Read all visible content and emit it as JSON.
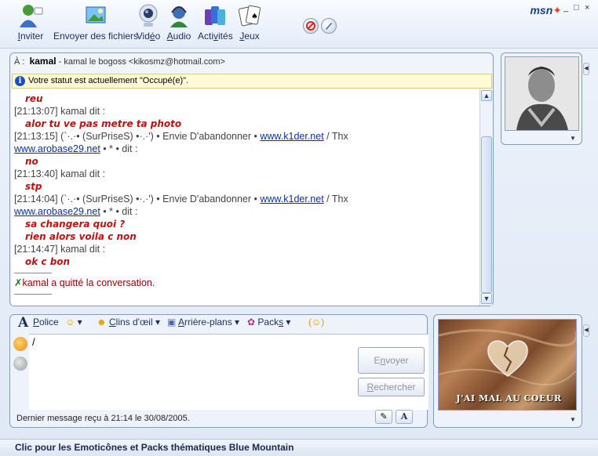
{
  "window": {
    "brand": "msn",
    "controls": [
      "_",
      "□",
      "×"
    ]
  },
  "toolbar": {
    "items": [
      {
        "label_pre": "",
        "label_key": "I",
        "label_post": "nviter",
        "icon": "invite-contacts-icon"
      },
      {
        "label_pre": "Envoyer des fichiers",
        "label_key": "",
        "label_post": "",
        "icon": "send-files-icon"
      },
      {
        "label_pre": "Vid",
        "label_key": "é",
        "label_post": "o",
        "icon": "webcam-icon"
      },
      {
        "label_pre": "",
        "label_key": "A",
        "label_post": "udio",
        "icon": "headset-icon"
      },
      {
        "label_pre": "Acti",
        "label_key": "v",
        "label_post": "ités",
        "icon": "activities-icon"
      },
      {
        "label_pre": "",
        "label_key": "J",
        "label_post": "eux",
        "icon": "cards-icon"
      }
    ]
  },
  "conversation": {
    "to_prefix": "À :",
    "contact_name": "kamal",
    "contact_details": " - kamal le bogoss <kikosmz@hotmail.com>",
    "status_notice": "Votre statut est actuellement \"Occupé(e)\"."
  },
  "history": [
    {
      "type": "msg",
      "text": "reu"
    },
    {
      "type": "sys",
      "text": "[21:13:07] kamal dit :"
    },
    {
      "type": "msg",
      "text": "alor tu ve pas metre ta photo"
    },
    {
      "type": "sys-link",
      "pre": "[21:13:15] (`·.·• (SurPriseS) •·.·') • Envie D'abandonner • ",
      "link": "www.k1der.net",
      "post": " / Thx"
    },
    {
      "type": "sys-link2",
      "link": "www.arobase29.net",
      "post": " • * • dit :"
    },
    {
      "type": "msg",
      "text": "no"
    },
    {
      "type": "sys",
      "text": "[21:13:40] kamal dit :"
    },
    {
      "type": "msg",
      "text": "stp"
    },
    {
      "type": "sys-link",
      "pre": "[21:14:04] (`·.·• (SurPriseS) •·.·') • Envie D'abandonner • ",
      "link": "www.k1der.net",
      "post": " / Thx"
    },
    {
      "type": "sys-link2",
      "link": "www.arobase29.net",
      "post": " • * • dit :"
    },
    {
      "type": "msg",
      "text": "sa changera quoi ?"
    },
    {
      "type": "msg",
      "text": "rien alors voila c non"
    },
    {
      "type": "sys",
      "text": "[21:14:47] kamal dit :"
    },
    {
      "type": "msg",
      "text": "ok c bon"
    },
    {
      "type": "sep"
    },
    {
      "type": "leave",
      "text": "kamal a quitté la conversation."
    },
    {
      "type": "sep"
    }
  ],
  "format_bar": {
    "font_label_key": "P",
    "font_label_rest": "olice",
    "winks_key": "C",
    "winks_rest": "lins d'œil",
    "backgrounds_key": "A",
    "backgrounds_rest": "rrière-plans",
    "packs_pre": "Pack",
    "packs_key": "s"
  },
  "input": {
    "value": "/",
    "send_pre": "E",
    "send_key": "n",
    "send_post": "voyer",
    "search_key": "R",
    "search_post": "echercher"
  },
  "footer": {
    "last_message": "Dernier message reçu à 21:14 le 30/08/2005."
  },
  "display_picture": {
    "caption": "J'AI MAL AU COEUR"
  },
  "status_bar": {
    "text": "Clic pour les Emoticônes et Packs thématiques Blue Mountain"
  }
}
